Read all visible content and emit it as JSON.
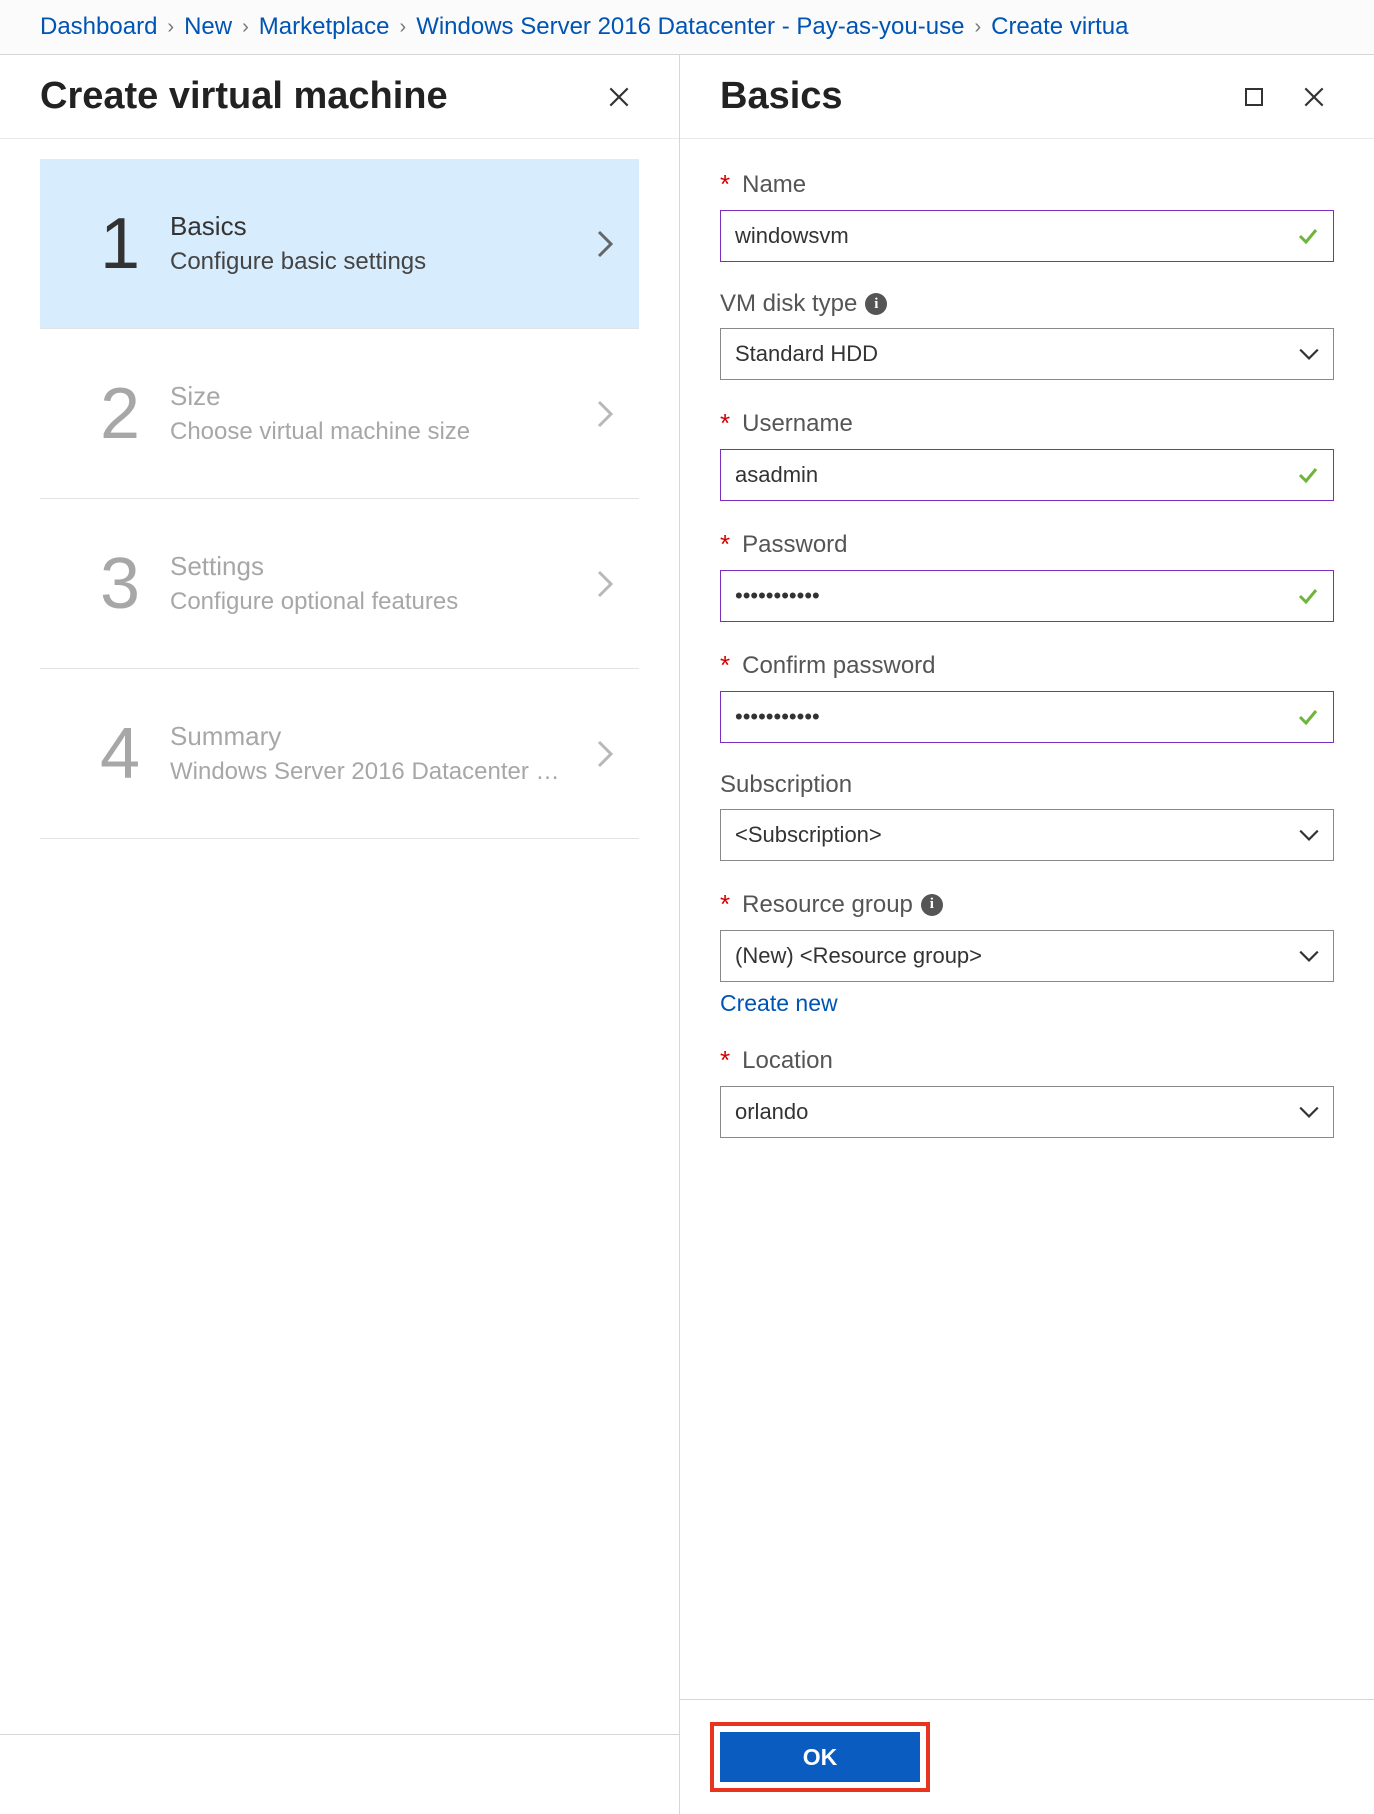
{
  "breadcrumb": {
    "items": [
      "Dashboard",
      "New",
      "Marketplace",
      "Windows Server 2016 Datacenter - Pay-as-you-use",
      "Create virtua"
    ]
  },
  "leftPanel": {
    "title": "Create virtual machine",
    "steps": [
      {
        "num": "1",
        "title": "Basics",
        "sub": "Configure basic settings",
        "active": true
      },
      {
        "num": "2",
        "title": "Size",
        "sub": "Choose virtual machine size",
        "active": false
      },
      {
        "num": "3",
        "title": "Settings",
        "sub": "Configure optional features",
        "active": false
      },
      {
        "num": "4",
        "title": "Summary",
        "sub": "Windows Server 2016 Datacenter …",
        "active": false
      }
    ]
  },
  "rightPanel": {
    "title": "Basics",
    "fields": {
      "name": {
        "label": "Name",
        "value": "windowsvm",
        "required": true,
        "validated": true
      },
      "diskType": {
        "label": "VM disk type",
        "value": "Standard HDD",
        "required": false,
        "info": true
      },
      "username": {
        "label": "Username",
        "value": "asadmin",
        "required": true,
        "validated": true
      },
      "password": {
        "label": "Password",
        "value": "•••••••••••",
        "required": true,
        "validated": true
      },
      "confirm": {
        "label": "Confirm password",
        "value": "•••••••••••",
        "required": true,
        "validated": true
      },
      "subscription": {
        "label": "Subscription",
        "value": "<Subscription>",
        "required": false
      },
      "resourceGroup": {
        "label": "Resource group",
        "value": "(New)  <Resource group>",
        "required": true,
        "info": true
      },
      "createNew": {
        "label": "Create new"
      },
      "location": {
        "label": "Location",
        "value": "orlando",
        "required": true
      }
    },
    "ok": "OK"
  }
}
